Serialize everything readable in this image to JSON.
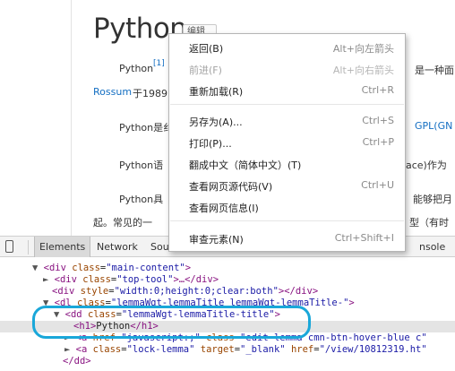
{
  "page": {
    "title": "Python",
    "edit_label": "编辑",
    "sup_ref": "[1]",
    "lines": [
      "Python",
      "是一种面",
      "Rossum",
      "于1989",
      "Python是纟",
      "GPL(GN",
      "Python语",
      "ace)作为",
      "Python具",
      "能够把月",
      "起。常见的一",
      "型（有时"
    ]
  },
  "context_menu": {
    "items": [
      {
        "label": "返回(B)",
        "shortcut": "Alt+向左箭头",
        "enabled": true
      },
      {
        "label": "前进(F)",
        "shortcut": "Alt+向右箭头",
        "enabled": false
      },
      {
        "label": "重新加载(R)",
        "shortcut": "Ctrl+R",
        "enabled": true
      },
      {
        "label": "另存为(A)...",
        "shortcut": "Ctrl+S",
        "enabled": true
      },
      {
        "label": "打印(P)...",
        "shortcut": "Ctrl+P",
        "enabled": true
      },
      {
        "label": "翻成中文（简体中文）(T)",
        "shortcut": "",
        "enabled": true
      },
      {
        "label": "查看网页源代码(V)",
        "shortcut": "Ctrl+U",
        "enabled": true
      },
      {
        "label": "查看网页信息(I)",
        "shortcut": "",
        "enabled": true
      },
      {
        "label": "审查元素(N)",
        "shortcut": "Ctrl+Shift+I",
        "enabled": true
      }
    ]
  },
  "devtools": {
    "tabs": [
      "Elements",
      "Network",
      "Sou",
      "nsole"
    ],
    "active_tab": "Elements",
    "dom": [
      {
        "tri": "▼",
        "tag": "div",
        "attrs": [
          [
            "class",
            "main-content"
          ]
        ],
        "tail": ">"
      },
      {
        "tri": "►",
        "tag": "div",
        "attrs": [
          [
            "class",
            "top-tool"
          ]
        ],
        "tail": ">…</div>"
      },
      {
        "tri": "",
        "tag": "div",
        "attrs": [
          [
            "style",
            "width:0;height:0;clear:both"
          ]
        ],
        "tail": "></div>"
      },
      {
        "tri": "▼",
        "tag": "dl",
        "attrs": [
          [
            "class",
            "lemmaWgt-lemmaTitle lemmaWgt-lemmaTitle-"
          ]
        ],
        "tail": ">"
      },
      {
        "tri": "▼",
        "tag": "dd",
        "attrs": [
          [
            "class",
            "lemmaWgt-lemmaTitle-title"
          ]
        ],
        "tail": ">"
      },
      {
        "tri": "",
        "tag": "h1",
        "attrs": [],
        "text": "Python",
        "close": "</h1>",
        "selected": true
      },
      {
        "tri": "►",
        "tag": "a",
        "attrs": [
          [
            "href",
            "javascript:;"
          ],
          [
            "class",
            "edit-lemma cmn-btn-hover-blue c"
          ]
        ],
        "tail": ""
      },
      {
        "tri": "►",
        "tag": "a",
        "attrs": [
          [
            "class",
            "lock-lemma"
          ],
          [
            "target",
            "_blank"
          ],
          [
            "href",
            "/view/10812319.ht"
          ]
        ],
        "tail": ""
      },
      {
        "tri": "",
        "tag": "",
        "attrs": [],
        "raw": "</dd>"
      }
    ]
  },
  "colors": {
    "annotation": "#19a7d9",
    "link": "#136ec2",
    "tag": "#881280",
    "attr_name": "#994500",
    "attr_value": "#1a1aa6",
    "selected_row": "#e4e4e4"
  }
}
